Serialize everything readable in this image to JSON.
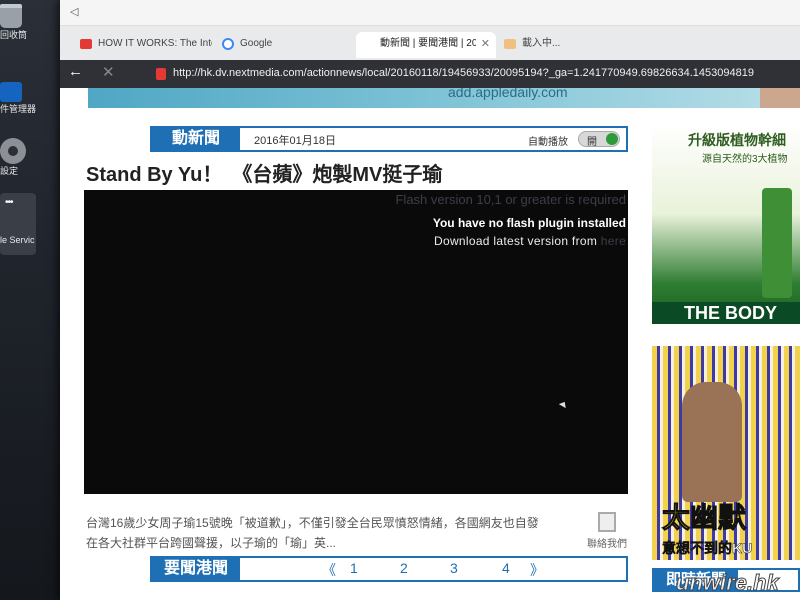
{
  "desktop": {
    "icons": [
      {
        "label": "回收筒",
        "name": "trash-icon"
      },
      {
        "label": "件管理器",
        "name": "file-manager-icon"
      },
      {
        "label": "設定",
        "name": "gear-icon"
      },
      {
        "label": "le Servic",
        "name": "services-icon"
      }
    ]
  },
  "browser": {
    "tabs": [
      {
        "title": "HOW IT WORKS: The Inte",
        "favicon_color": "#e53935"
      },
      {
        "title": "Google",
        "favicon_color": "#4285f4"
      },
      {
        "title": "動新聞 | 要聞港聞 | 20160...",
        "favicon_color": "#ffffff"
      },
      {
        "title": "載入中...",
        "favicon_color": "#f0c080"
      }
    ],
    "close_glyph": "✕",
    "new_tab_glyph": "+",
    "url": "http://hk.dv.nextmedia.com/actionnews/local/20160118/19456933/20095194?_ga=1.241770949.69826634.1453094819"
  },
  "page": {
    "banner_text": "add.appledaily.com",
    "section_title": "動新聞",
    "date": "2016年01月18日",
    "autoplay_label": "自動播放",
    "autoplay_state": "開",
    "article_title": "Stand By Yu！　《台蘋》炮製MV挺子瑜",
    "flash_version": "Flash version 10,1 or greater is required",
    "flash_none": "You have no flash plugin installed",
    "flash_download": "Download latest version from",
    "flash_here": "here",
    "summary": "台灣16歲少女周子瑜15號晚「被道歉」，不僅引發全台民眾憤怒情緒，各國網友也自發在各大社群平台跨國聲援，以子瑜的「瑜」英...",
    "contact_label": "聯絡我們",
    "news_section_title": "要聞港聞",
    "pagination": {
      "prev": "《",
      "pages": [
        "1",
        "2",
        "3",
        "4"
      ],
      "next": "》"
    },
    "ads": {
      "ad1_title": "升級版植物幹細",
      "ad1_sub": "源自天然的3大植物",
      "ad1_brand": "THE BODY",
      "ad2_text": "太幽默",
      "ad2_sub": "意想不到的KU"
    },
    "live_news_title": "即時新聞",
    "watermark": "unwire.hk"
  }
}
